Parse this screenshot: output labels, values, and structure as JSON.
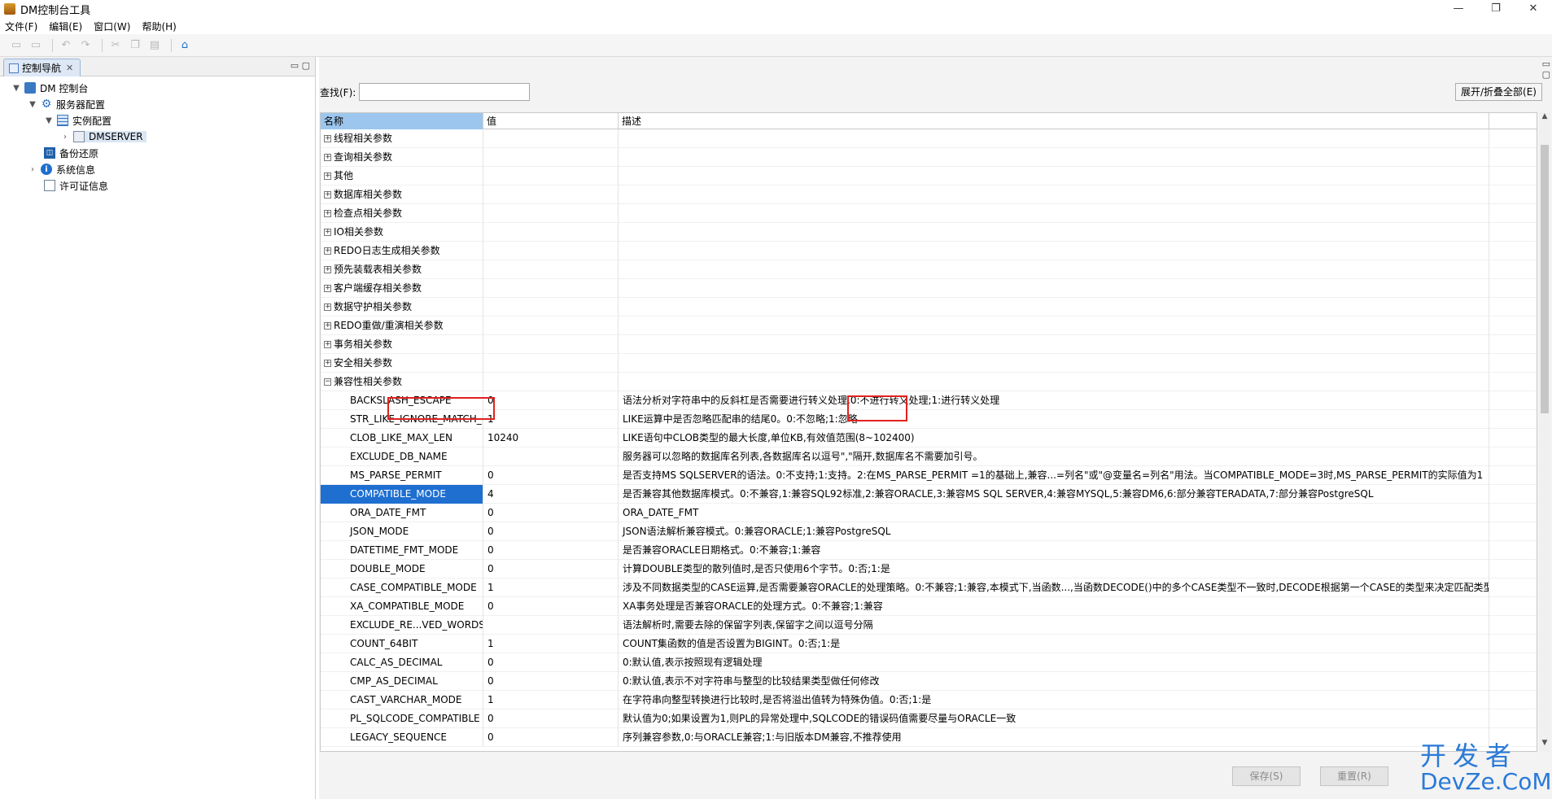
{
  "window": {
    "title": "DM控制台工具",
    "min": "—",
    "restore": "❐",
    "close": "✕"
  },
  "menu": [
    "文件(F)",
    "编辑(E)",
    "窗口(W)",
    "帮助(H)"
  ],
  "nav_tab": {
    "label": "控制导航",
    "close": "✕"
  },
  "tree": {
    "root": "DM 控制台",
    "server_config": "服务器配置",
    "instance_config": "实例配置",
    "server": "DMSERVER",
    "backup": "备份还原",
    "sysinfo": "系统信息",
    "license": "许可证信息"
  },
  "search": {
    "label": "查找(F):",
    "value": ""
  },
  "expand_all": "展开/折叠全部(E)",
  "columns": {
    "name": "名称",
    "value": "值",
    "desc": "描述"
  },
  "groups": [
    "线程相关参数",
    "查询相关参数",
    "其他",
    "数据库相关参数",
    "检查点相关参数",
    "IO相关参数",
    "REDO日志生成相关参数",
    "预先装载表相关参数",
    "客户端缓存相关参数",
    "数据守护相关参数",
    "REDO重做/重演相关参数",
    "事务相关参数",
    "安全相关参数"
  ],
  "expanded_group": "兼容性相关参数",
  "params": [
    {
      "name": "BACKSLASH_ESCAPE",
      "value": "0",
      "desc": "语法分析对字符串中的反斜杠是否需要进行转义处理,0:不进行转义处理;1:进行转义处理"
    },
    {
      "name": "STR_LIKE_IGNORE_MATCH_E",
      "value": "1",
      "desc": "LIKE运算中是否忽略匹配串的结尾0。0:不忽略;1:忽略"
    },
    {
      "name": "CLOB_LIKE_MAX_LEN",
      "value": "10240",
      "desc": "LIKE语句中CLOB类型的最大长度,单位KB,有效值范围(8~102400)"
    },
    {
      "name": "EXCLUDE_DB_NAME",
      "value": "",
      "desc": "服务器可以忽略的数据库名列表,各数据库名以逗号\",\"隔开,数据库名不需要加引号。"
    },
    {
      "name": "MS_PARSE_PERMIT",
      "value": "0",
      "desc": "是否支持MS SQLSERVER的语法。0:不支持;1:支持。2:在MS_PARSE_PERMIT =1的基础上,兼容...=列名\"或\"@变量名=列名\"用法。当COMPATIBLE_MODE=3时,MS_PARSE_PERMIT的实际值为1"
    },
    {
      "name": "COMPATIBLE_MODE",
      "value": "4",
      "desc": "是否兼容其他数据库模式。0:不兼容,1:兼容SQL92标准,2:兼容ORACLE,3:兼容MS SQL SERVER,4:兼容MYSQL,5:兼容DM6,6:部分兼容TERADATA,7:部分兼容PostgreSQL"
    },
    {
      "name": "ORA_DATE_FMT",
      "value": "0",
      "desc": "ORA_DATE_FMT"
    },
    {
      "name": "JSON_MODE",
      "value": "0",
      "desc": "JSON语法解析兼容模式。0:兼容ORACLE;1:兼容PostgreSQL"
    },
    {
      "name": "DATETIME_FMT_MODE",
      "value": "0",
      "desc": "是否兼容ORACLE日期格式。0:不兼容;1:兼容"
    },
    {
      "name": "DOUBLE_MODE",
      "value": "0",
      "desc": "计算DOUBLE类型的散列值时,是否只使用6个字节。0:否;1:是"
    },
    {
      "name": "CASE_COMPATIBLE_MODE",
      "value": "1",
      "desc": "涉及不同数据类型的CASE运算,是否需要兼容ORACLE的处理策略。0:不兼容;1:兼容,本模式下,当函数...,当函数DECODE()中的多个CASE类型不一致时,DECODE根据第一个CASE的类型来决定匹配类型"
    },
    {
      "name": "XA_COMPATIBLE_MODE",
      "value": "0",
      "desc": "XA事务处理是否兼容ORACLE的处理方式。0:不兼容;1:兼容"
    },
    {
      "name": "EXCLUDE_RE...VED_WORDS",
      "value": "",
      "desc": "语法解析时,需要去除的保留字列表,保留字之间以逗号分隔"
    },
    {
      "name": "COUNT_64BIT",
      "value": "1",
      "desc": "COUNT集函数的值是否设置为BIGINT。0:否;1:是"
    },
    {
      "name": "CALC_AS_DECIMAL",
      "value": "0",
      "desc": "0:默认值,表示按照现有逻辑处理"
    },
    {
      "name": "CMP_AS_DECIMAL",
      "value": "0",
      "desc": "0:默认值,表示不对字符串与整型的比较结果类型做任何修改"
    },
    {
      "name": "CAST_VARCHAR_MODE",
      "value": "1",
      "desc": "在字符串向整型转换进行比较时,是否将溢出值转为特殊伪值。0:否;1:是"
    },
    {
      "name": "PL_SQLCODE_COMPATIBLE",
      "value": "0",
      "desc": "默认值为0;如果设置为1,则PL的异常处理中,SQLCODE的错误码值需要尽量与ORACLE一致"
    },
    {
      "name": "LEGACY_SEQUENCE",
      "value": "0",
      "desc": "序列兼容参数,0:与ORACLE兼容;1:与旧版本DM兼容,不推荐使用"
    }
  ],
  "buttons": {
    "save": "保存(S)",
    "reset": "重置(R)"
  },
  "watermark": {
    "top": "开发者",
    "bottom": "DevZe.CoM"
  },
  "colors": {
    "selection": "#1f6fd1",
    "header_selected": "#9cc6ee",
    "highlight_box": "#e0221f",
    "watermark": "#2a7ad8"
  }
}
